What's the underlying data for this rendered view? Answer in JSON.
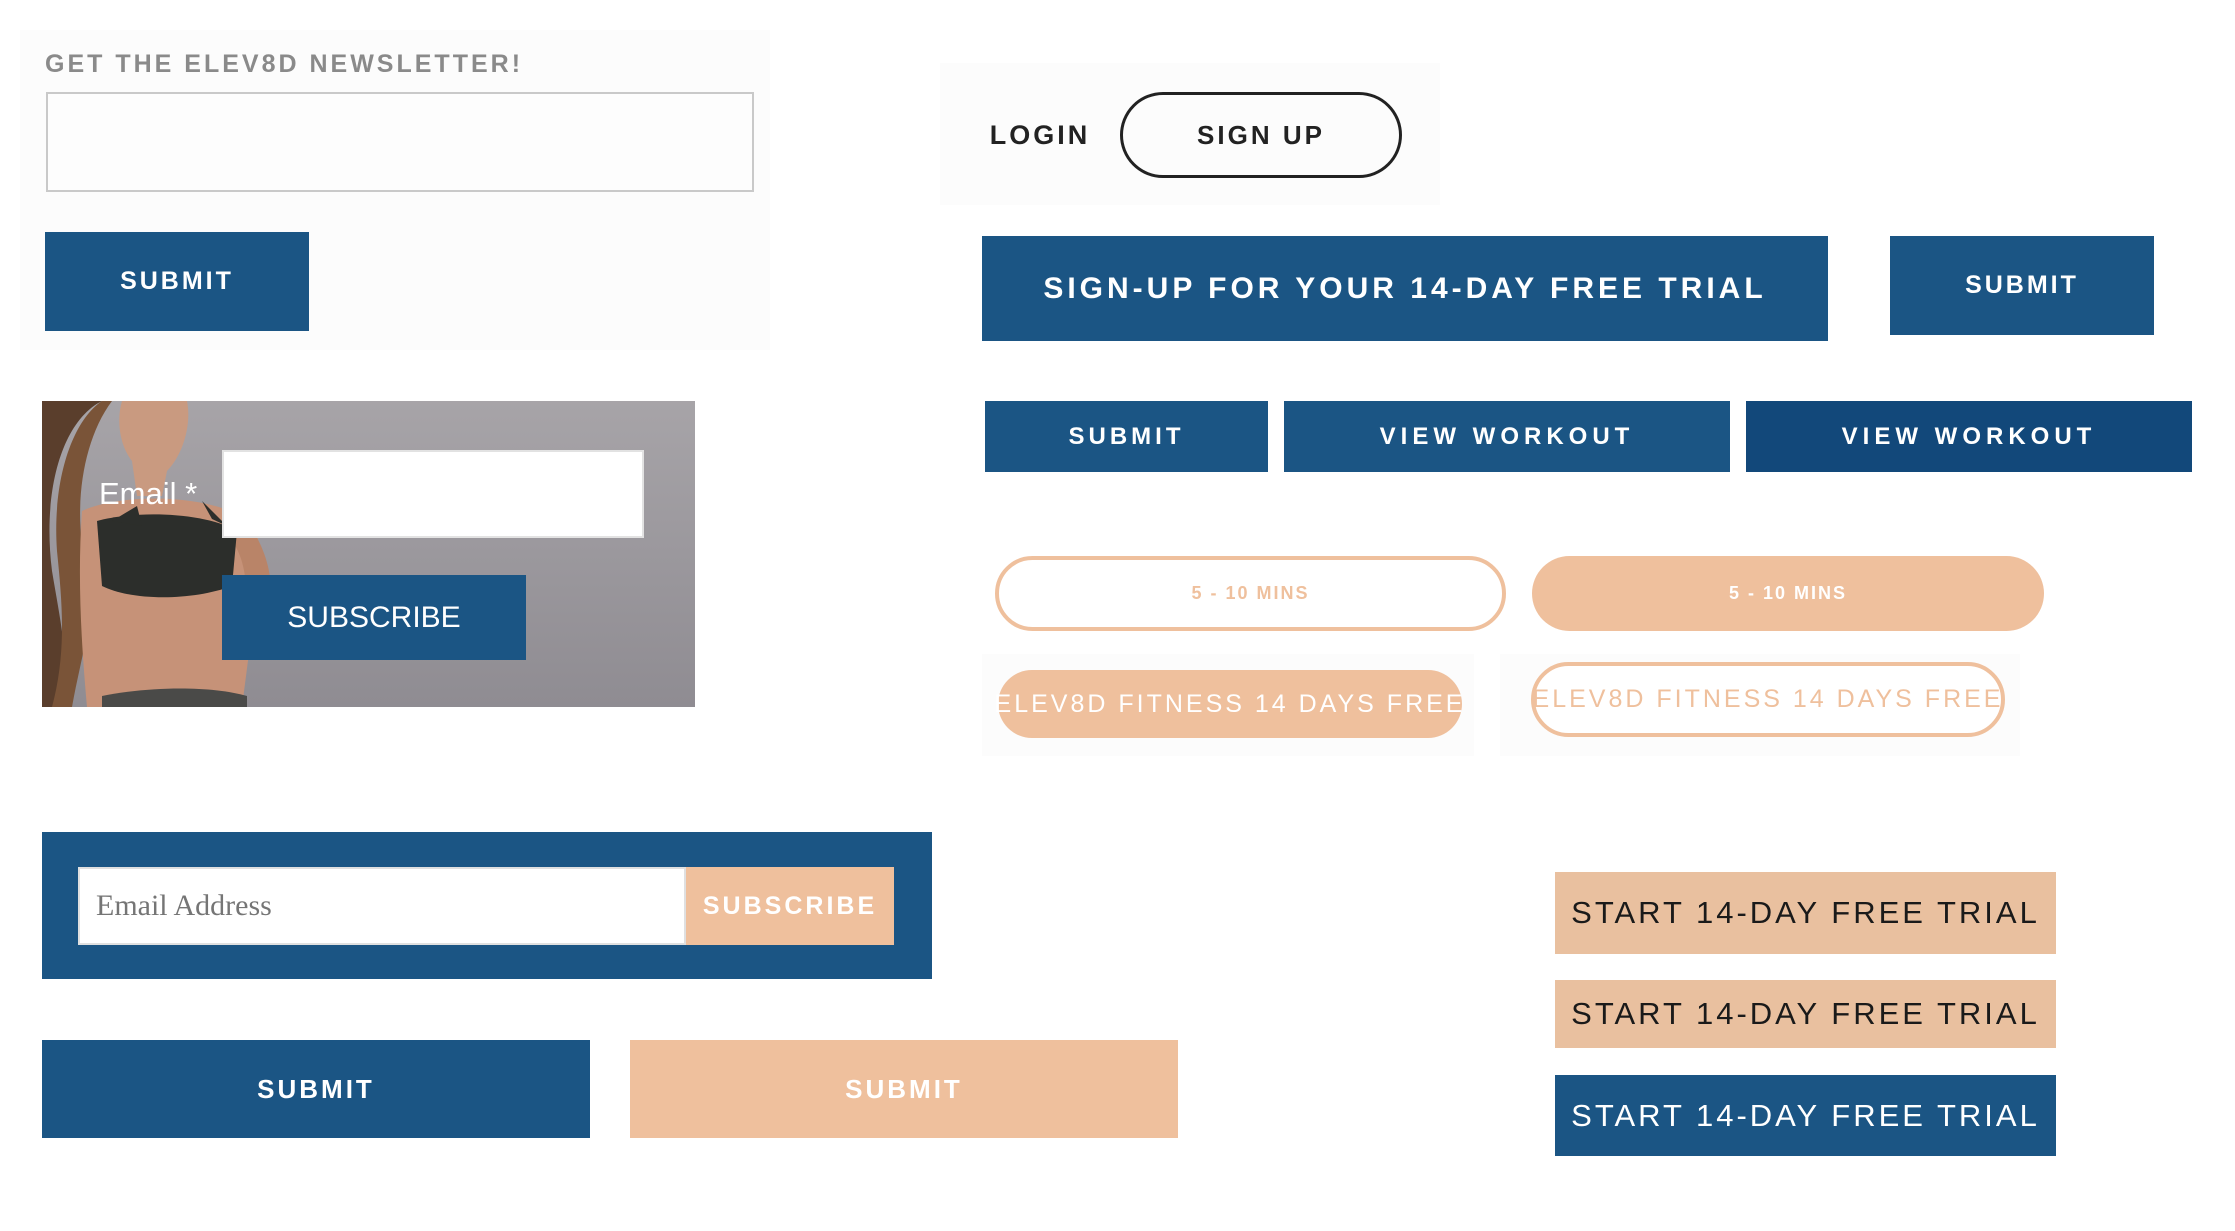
{
  "colors": {
    "brand_blue": "#1b5584",
    "dark_navy": "#12487a",
    "peach": "#efc09d",
    "tan": "#e9c09f",
    "white": "#ffffff"
  },
  "newsletter": {
    "label": "GET THE ELEV8D NEWSLETTER!",
    "input_value": "",
    "submit_label": "SUBMIT"
  },
  "auth": {
    "login_label": "LOGIN",
    "signup_label": "SIGN UP"
  },
  "trial_row": {
    "trial_button_label": "SIGN-UP FOR YOUR 14-DAY FREE TRIAL",
    "submit_label": "SUBMIT"
  },
  "workout_row": {
    "submit_label": "SUBMIT",
    "view_workout_label": "VIEW WORKOUT",
    "view_workout_dark_label": "VIEW WORKOUT"
  },
  "photo_form": {
    "email_label": "Email",
    "required_mark": "*",
    "input_value": "",
    "subscribe_label": "SUBSCRIBE"
  },
  "pills": {
    "duration_outline": "5 - 10 MINS",
    "duration_filled": "5 - 10 MINS",
    "promo_filled": "ELEV8D FITNESS 14 DAYS FREE",
    "promo_outline": "ELEV8D FITNESS 14 DAYS FREE"
  },
  "email_bar": {
    "placeholder": "Email Address",
    "subscribe_label": "SUBSCRIBE"
  },
  "bottom_buttons": {
    "submit_blue": "SUBMIT",
    "submit_peach": "SUBMIT"
  },
  "start_trial": {
    "tan_1": "START 14-DAY FREE TRIAL",
    "tan_2": "START 14-DAY FREE TRIAL",
    "blue": "START 14-DAY FREE TRIAL"
  },
  "icons": {
    "photo": "woman-fitness-photo"
  }
}
